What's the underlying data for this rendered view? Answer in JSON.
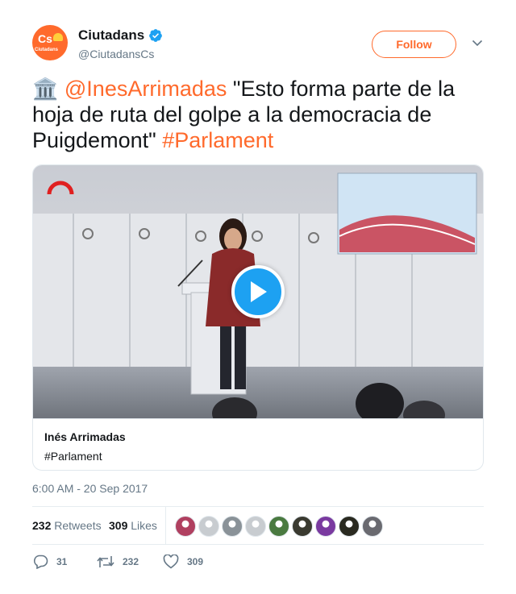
{
  "account": {
    "display_name": "Ciutadans",
    "handle": "@CiutadansCs",
    "avatar_text": "Cs",
    "avatar_subtext": "Ciutadans",
    "brand_color": "#ff6a2c",
    "verified": true
  },
  "follow_label": "Follow",
  "tweet": {
    "emoji": "🏛️",
    "mention": "@InesArrimadas",
    "quote": " \"Esto forma parte de la hoja de ruta del golpe a la democracia de Puigdemont\" ",
    "hashtag": "#Parlament"
  },
  "card": {
    "title": "Inés Arrimadas",
    "description": "#Parlament",
    "play_icon": "play-icon"
  },
  "timestamp": "6:00 AM - 20 Sep 2017",
  "stats": {
    "retweets_count": "232",
    "retweets_label": "Retweets",
    "likes_count": "309",
    "likes_label": "Likes"
  },
  "likers": [
    {
      "color": "#b04060"
    },
    {
      "color": "#c8ccd0"
    },
    {
      "color": "#8a9298"
    },
    {
      "color": "#c8ccd0"
    },
    {
      "color": "#4a7a40"
    },
    {
      "color": "#3a3a30"
    },
    {
      "color": "#7a3aa0"
    },
    {
      "color": "#2a2a20"
    },
    {
      "color": "#6a6a70"
    }
  ],
  "actions": {
    "reply_count": "31",
    "retweet_count": "232",
    "like_count": "309"
  },
  "colors": {
    "link": "#ff6a2c",
    "secondary_text": "#657786",
    "play_button": "#1da1f2"
  }
}
